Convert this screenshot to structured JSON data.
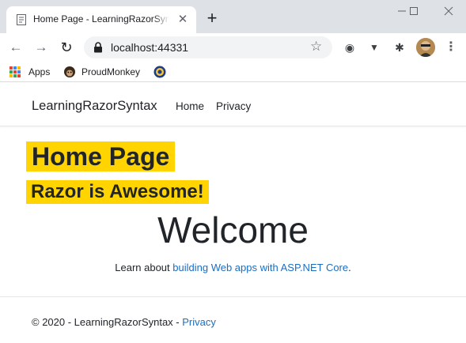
{
  "browser": {
    "tab": {
      "title": "Home Page - LearningRazorSyntax",
      "close": "✕"
    },
    "new_tab": "+",
    "window_controls": {
      "minimize": "—",
      "maximize": "☐",
      "close": "✕"
    },
    "nav": {
      "back": "←",
      "forward": "→",
      "reload": "↻"
    },
    "omnibox": {
      "url": "localhost:44331",
      "bookmark_star": "☆"
    },
    "extensions": [
      {
        "icon": "record-icon",
        "glyph": "◉"
      },
      {
        "icon": "vue-icon",
        "glyph": "▼"
      },
      {
        "icon": "puzzle-icon",
        "glyph": "✱"
      }
    ],
    "menu": "⋮",
    "bookmarks": [
      {
        "label": "Apps",
        "icon": "apps-grid-icon"
      },
      {
        "label": "ProudMonkey",
        "icon": "monkey-icon"
      },
      {
        "label": "",
        "icon": "badge-icon"
      }
    ]
  },
  "site": {
    "brand": "LearningRazorSyntax",
    "nav": [
      {
        "label": "Home"
      },
      {
        "label": "Privacy"
      }
    ],
    "heading": "Home Page",
    "subheading": "Razor is Awesome!",
    "welcome": "Welcome",
    "learn_prefix": "Learn about ",
    "learn_link": "building Web apps with ASP.NET Core",
    "learn_suffix": ".",
    "footer_text": "© 2020 - LearningRazorSyntax - ",
    "footer_link": "Privacy"
  },
  "colors": {
    "highlight": "#ffd400",
    "link": "#1b6ec2",
    "chrome_bg": "#dee1e6"
  }
}
